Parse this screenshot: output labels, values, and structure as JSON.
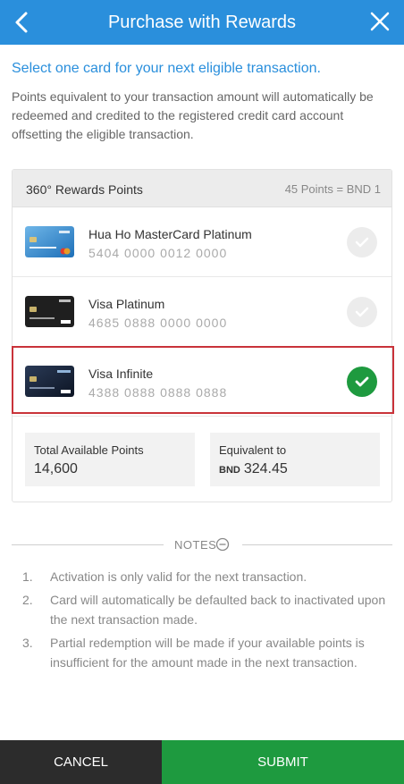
{
  "header": {
    "title": "Purchase with Rewards",
    "back_icon": "chevron-left-icon",
    "close_icon": "close-icon",
    "bg_color": "#2a8fdc"
  },
  "intro": {
    "title": "Select one card for your next eligible transaction.",
    "description": "Points equivalent to your transaction amount will automatically be redeemed and credited to the registered credit card account offsetting the eligible transaction."
  },
  "rewards": {
    "label": "360° Rewards Points",
    "rate": "45 Points = BND 1"
  },
  "cards": [
    {
      "name": "Hua Ho MasterCard Platinum",
      "number": "5404 0000 0012 0000",
      "selected": false
    },
    {
      "name": "Visa Platinum",
      "number": "4685 0888 0000 0000",
      "selected": false
    },
    {
      "name": "Visa Infinite",
      "number": "4388 0888 0888 0888",
      "selected": true
    }
  ],
  "stats": {
    "total_label": "Total Available Points",
    "total_value": "14,600",
    "equiv_label": "Equivalent to",
    "equiv_currency": "BND",
    "equiv_value": "324.45"
  },
  "notes": {
    "label": "NOTES",
    "toggle_icon": "minus-circle-icon",
    "items": [
      {
        "num": "1.",
        "text": "Activation is only valid for the next transaction."
      },
      {
        "num": "2.",
        "text": "Card will automatically be defaulted back to inactivated upon the next transaction made."
      },
      {
        "num": "3.",
        "text": "Partial redemption will be made if your available points is insufficient for the amount made in the next transaction."
      }
    ]
  },
  "buttons": {
    "cancel": "CANCEL",
    "submit": "SUBMIT"
  },
  "colors": {
    "accent": "#2a8fdc",
    "success": "#1e9a3f",
    "selection_border": "#c9333a"
  }
}
